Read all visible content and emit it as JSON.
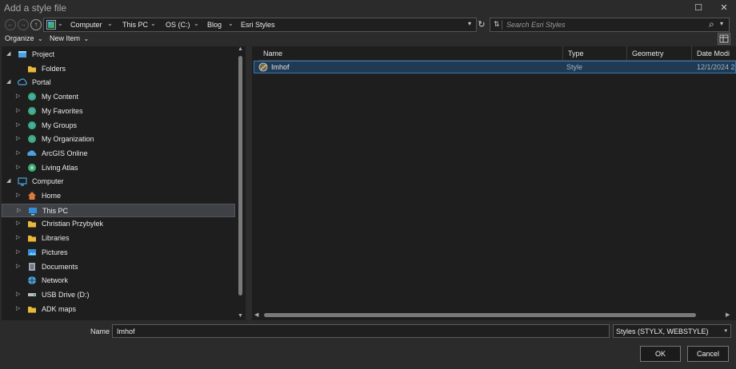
{
  "window": {
    "title": "Add a style file",
    "maximize_glyph": "☐",
    "close_glyph": "✕"
  },
  "nav": {
    "back_glyph": "←",
    "forward_glyph": "→",
    "up_glyph": "↑",
    "recent_glyph": "⌄",
    "breadcrumbs": [
      "Computer",
      "This PC",
      "OS (C:)",
      "Blog",
      "Esri Styles"
    ],
    "separator_glyph": "⌄",
    "address_dropdown_glyph": "▾",
    "refresh_glyph": "↻"
  },
  "search": {
    "placeholder": "Search Esri Styles",
    "sort_glyph": "⇅",
    "search_glyph": "⌕",
    "dropdown_glyph": "▾"
  },
  "toolbar": {
    "organize_label": "Organize",
    "new_item_label": "New Item",
    "dropdown_glyph": "⌄"
  },
  "tree": {
    "expanded_glyph": "◢",
    "collapsed_glyph": "▷",
    "items": [
      {
        "label": "Project",
        "icon": "project-icon",
        "level": 0,
        "arrow": "expanded"
      },
      {
        "label": "Folders",
        "icon": "folders-icon",
        "level": 1,
        "arrow": "none"
      },
      {
        "label": "Portal",
        "icon": "portal-icon",
        "level": 0,
        "arrow": "expanded"
      },
      {
        "label": "My Content",
        "icon": "my-content-icon",
        "level": 1,
        "arrow": "collapsed"
      },
      {
        "label": "My Favorites",
        "icon": "my-favorites-icon",
        "level": 1,
        "arrow": "collapsed"
      },
      {
        "label": "My Groups",
        "icon": "my-groups-icon",
        "level": 1,
        "arrow": "collapsed"
      },
      {
        "label": "My Organization",
        "icon": "my-organization-icon",
        "level": 1,
        "arrow": "collapsed"
      },
      {
        "label": "ArcGIS Online",
        "icon": "arcgis-online-icon",
        "level": 1,
        "arrow": "collapsed"
      },
      {
        "label": "Living Atlas",
        "icon": "living-atlas-icon",
        "level": 1,
        "arrow": "collapsed"
      },
      {
        "label": "Computer",
        "icon": "computer-icon",
        "level": 0,
        "arrow": "expanded"
      },
      {
        "label": "Home",
        "icon": "home-icon",
        "level": 1,
        "arrow": "collapsed"
      },
      {
        "label": "This PC",
        "icon": "this-pc-icon",
        "level": 1,
        "arrow": "collapsed",
        "selected": true
      },
      {
        "label": "Christian Przybylek",
        "icon": "user-folder-icon",
        "level": 1,
        "arrow": "collapsed"
      },
      {
        "label": "Libraries",
        "icon": "libraries-icon",
        "level": 1,
        "arrow": "collapsed"
      },
      {
        "label": "Pictures",
        "icon": "pictures-icon",
        "level": 1,
        "arrow": "collapsed"
      },
      {
        "label": "Documents",
        "icon": "documents-icon",
        "level": 1,
        "arrow": "collapsed"
      },
      {
        "label": "Network",
        "icon": "network-icon",
        "level": 1,
        "arrow": "none"
      },
      {
        "label": "USB Drive (D:)",
        "icon": "usb-drive-icon",
        "level": 1,
        "arrow": "collapsed"
      },
      {
        "label": "ADK maps",
        "icon": "folder-icon",
        "level": 1,
        "arrow": "collapsed"
      }
    ]
  },
  "list": {
    "columns": [
      "Name",
      "Type",
      "Geometry",
      "Date Modi"
    ],
    "rows": [
      {
        "name": "Imhof",
        "type": "Style",
        "geometry": "",
        "date": "12/1/2024 2"
      }
    ]
  },
  "footer": {
    "name_label": "Name",
    "name_value": "Imhof",
    "file_type": "Styles (STYLX, WEBSTYLE)",
    "ok_label": "OK",
    "cancel_label": "Cancel"
  },
  "colors": {
    "accent": "#3a79b0",
    "selection": "#1f3a52",
    "folder": "#e8b93a",
    "portal_blue": "#4aa3df",
    "globe_green": "#3fae6a"
  }
}
